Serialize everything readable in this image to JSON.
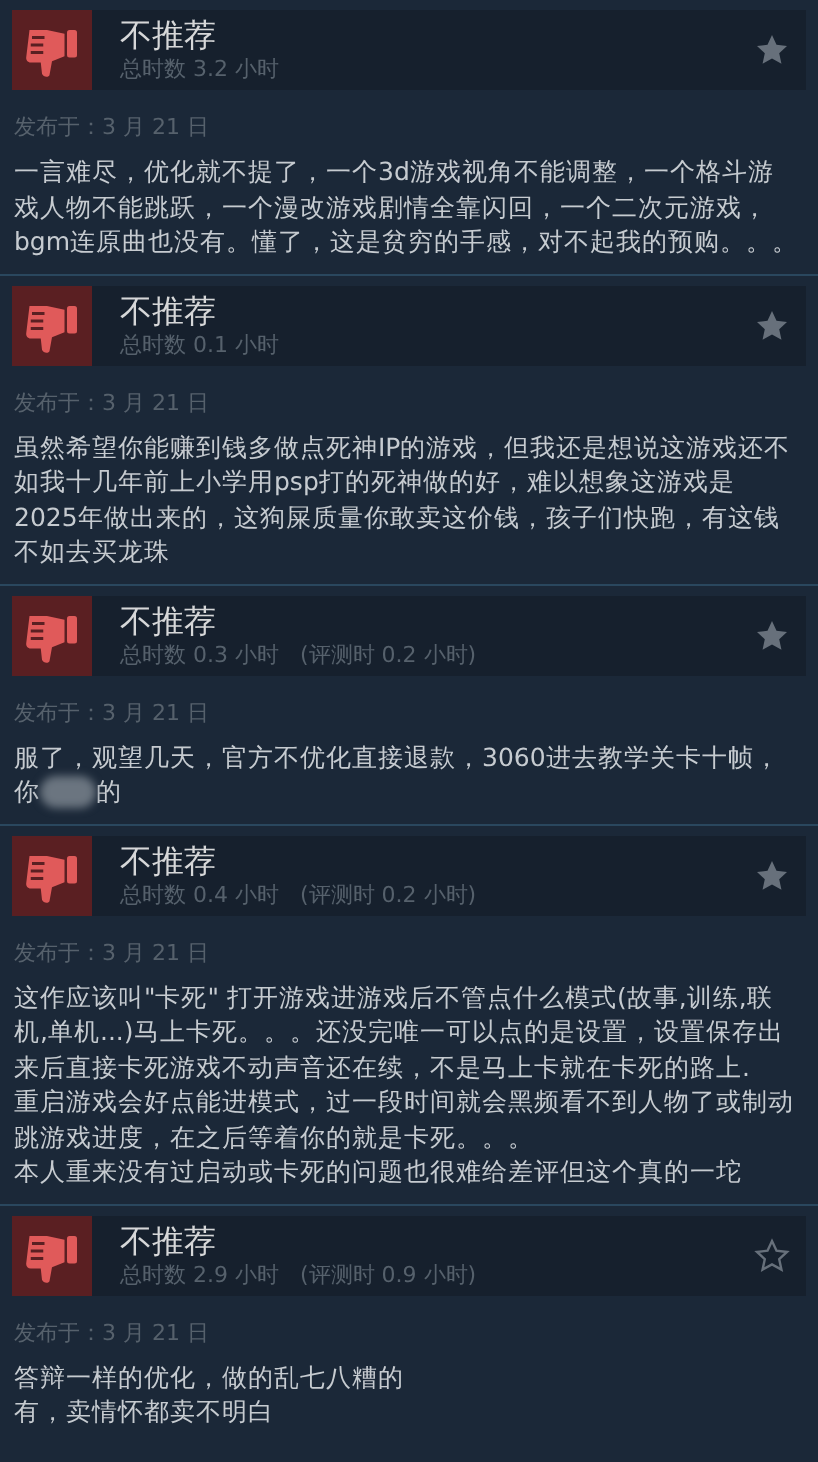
{
  "reviews": [
    {
      "verdict": "不推荐",
      "hours": "总时数 3.2 小时",
      "starred": true,
      "posted": "发布于：3 月 21 日",
      "lines": [
        {
          "kind": "text",
          "text": "一言难尽，优化就不提了，一个3d游戏视角不能调整，一个格斗游"
        },
        {
          "kind": "text",
          "text": "戏人物不能跳跃，一个漫改游戏剧情全靠闪回，一个二次元游戏，"
        },
        {
          "kind": "text",
          "text": "bgm连原曲也没有。懂了，这是贫穷的手感，对不起我的预购。。。"
        }
      ]
    },
    {
      "verdict": "不推荐",
      "hours": "总时数 0.1 小时",
      "starred": true,
      "posted": "发布于：3 月 21 日",
      "lines": [
        {
          "kind": "text",
          "text": "虽然希望你能赚到钱多做点死神IP的游戏，但我还是想说这游戏还不"
        },
        {
          "kind": "text",
          "text": "如我十几年前上小学用psp打的死神做的好，难以想象这游戏是"
        },
        {
          "kind": "text",
          "text": "2025年做出来的，这狗屎质量你敢卖这价钱，孩子们快跑，有这钱"
        },
        {
          "kind": "text",
          "text": "不如去买龙珠"
        }
      ]
    },
    {
      "verdict": "不推荐",
      "hours": "总时数 0.3 小时   (评测时 0.2 小时)",
      "starred": true,
      "posted": "发布于：3 月 21 日",
      "lines": [
        {
          "kind": "text",
          "text": "服了，观望几天，官方不优化直接退款，3060进去教学关卡十帧，"
        },
        {
          "kind": "redacted",
          "before": "你",
          "after": "的"
        }
      ]
    },
    {
      "verdict": "不推荐",
      "hours": "总时数 0.4 小时   (评测时 0.2 小时)",
      "starred": true,
      "posted": "发布于：3 月 21 日",
      "lines": [
        {
          "kind": "text",
          "text": "这作应该叫\"卡死\" 打开游戏进游戏后不管点什么模式(故事,训练,联"
        },
        {
          "kind": "text",
          "text": "机,单机...)马上卡死。。。还没完唯一可以点的是设置，设置保存出"
        },
        {
          "kind": "text",
          "text": "来后直接卡死游戏不动声音还在续，不是马上卡就在卡死的路上."
        },
        {
          "kind": "text",
          "text": "重启游戏会好点能进模式，过一段时间就会黑频看不到人物了或制动"
        },
        {
          "kind": "text",
          "text": "跳游戏进度，在之后等着你的就是卡死。。。"
        },
        {
          "kind": "text",
          "text": "本人重来没有过启动或卡死的问题也很难给差评但这个真的一坨"
        }
      ]
    },
    {
      "verdict": "不推荐",
      "hours": "总时数 2.9 小时   (评测时 0.9 小时)",
      "starred": false,
      "posted": "发布于：3 月 21 日",
      "lines": [
        {
          "kind": "text",
          "text": "答辩一样的优化，做的乱七八糟的"
        },
        {
          "kind": "text",
          "text": "有，卖情怀都卖不明白"
        }
      ]
    }
  ]
}
